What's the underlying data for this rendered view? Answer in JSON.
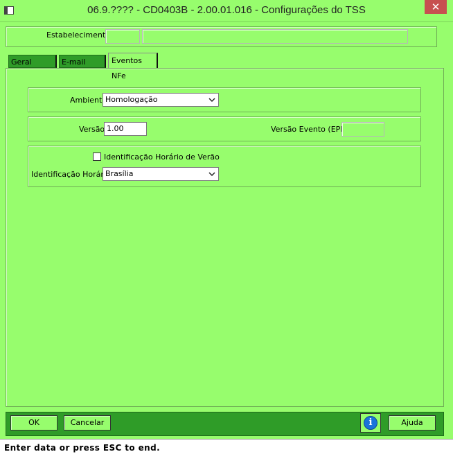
{
  "window": {
    "title": "06.9.???? - CD0403B - 2.00.01.016 - Configurações do TSS",
    "close_glyph": "✕"
  },
  "header": {
    "estabelecimento_label": "Estabelecimento:"
  },
  "tabs": [
    {
      "label": "Geral",
      "active": false
    },
    {
      "label": "E-mail",
      "active": false
    },
    {
      "label": "Eventos NFe",
      "active": true
    }
  ],
  "form": {
    "ambiente_label": "Ambiente:",
    "ambiente_value": "Homologação",
    "versao_label": "Versão:",
    "versao_value": "1.00",
    "versao_evento_label": "Versão Evento (EPP):",
    "horario_verao_label": "Identificação Horário de Verão",
    "horario_verao_checked": false,
    "ident_horario_label": "Identificação Horário:",
    "ident_horario_value": "Brasília"
  },
  "footer": {
    "ok_label": "OK",
    "cancel_label": "Cancelar",
    "info_glyph": "i",
    "help_label": "Ajuda"
  },
  "status": {
    "message": "Enter data or press ESC to end."
  },
  "colors": {
    "background": "#97fd6d",
    "tab_inactive": "#2f9c28",
    "footer_bar": "#2f9c28",
    "close_button": "#c75050",
    "info_icon": "#1a73d9"
  },
  "icons": {
    "system_menu": "window-icon",
    "close": "close-icon",
    "info": "info-icon",
    "dropdown": "chevron-down-icon"
  }
}
